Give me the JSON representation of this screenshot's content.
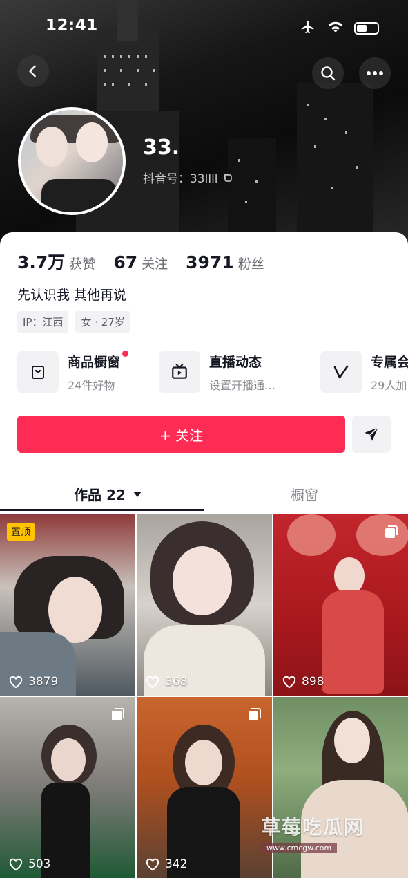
{
  "status_bar": {
    "time": "12:41"
  },
  "profile": {
    "name": "33.",
    "douyin_id": "抖音号：33llll",
    "stats": [
      {
        "value": "3.7万",
        "label": "获赞"
      },
      {
        "value": "67",
        "label": "关注"
      },
      {
        "value": "3971",
        "label": "粉丝"
      }
    ],
    "bio": "先认识我 其他再说",
    "tags": [
      "IP：江西",
      "女 · 27岁"
    ]
  },
  "shortcuts": [
    {
      "title": "商品橱窗",
      "subtitle": "24件好物",
      "icon": "shopping-bag-icon",
      "has_dot": true
    },
    {
      "title": "直播动态",
      "subtitle": "设置开播通…",
      "icon": "tv-icon",
      "has_dot": false
    },
    {
      "title": "专属会",
      "subtitle": "29人加",
      "icon": "v-badge-icon",
      "has_dot": false
    }
  ],
  "actions": {
    "follow_label": "+ 关注"
  },
  "tabs": {
    "works_label": "作品 22",
    "showcase_label": "橱窗"
  },
  "videos": [
    {
      "likes": "3879",
      "pinned": true,
      "pin_label": "置顶",
      "multi": false
    },
    {
      "likes": "368",
      "pinned": false,
      "multi": false
    },
    {
      "likes": "898",
      "pinned": false,
      "multi": true
    },
    {
      "likes": "503",
      "pinned": false,
      "multi": true
    },
    {
      "likes": "342",
      "pinned": false,
      "multi": true
    },
    {
      "likes": "",
      "pinned": false,
      "multi": false
    }
  ],
  "watermark": {
    "title": "草莓吃瓜网",
    "url": "www.cmcgw.com"
  },
  "colors": {
    "accent": "#fe2c55",
    "pin_badge": "#ffc300",
    "text_primary": "#161823",
    "text_secondary": "#6b6d73"
  }
}
